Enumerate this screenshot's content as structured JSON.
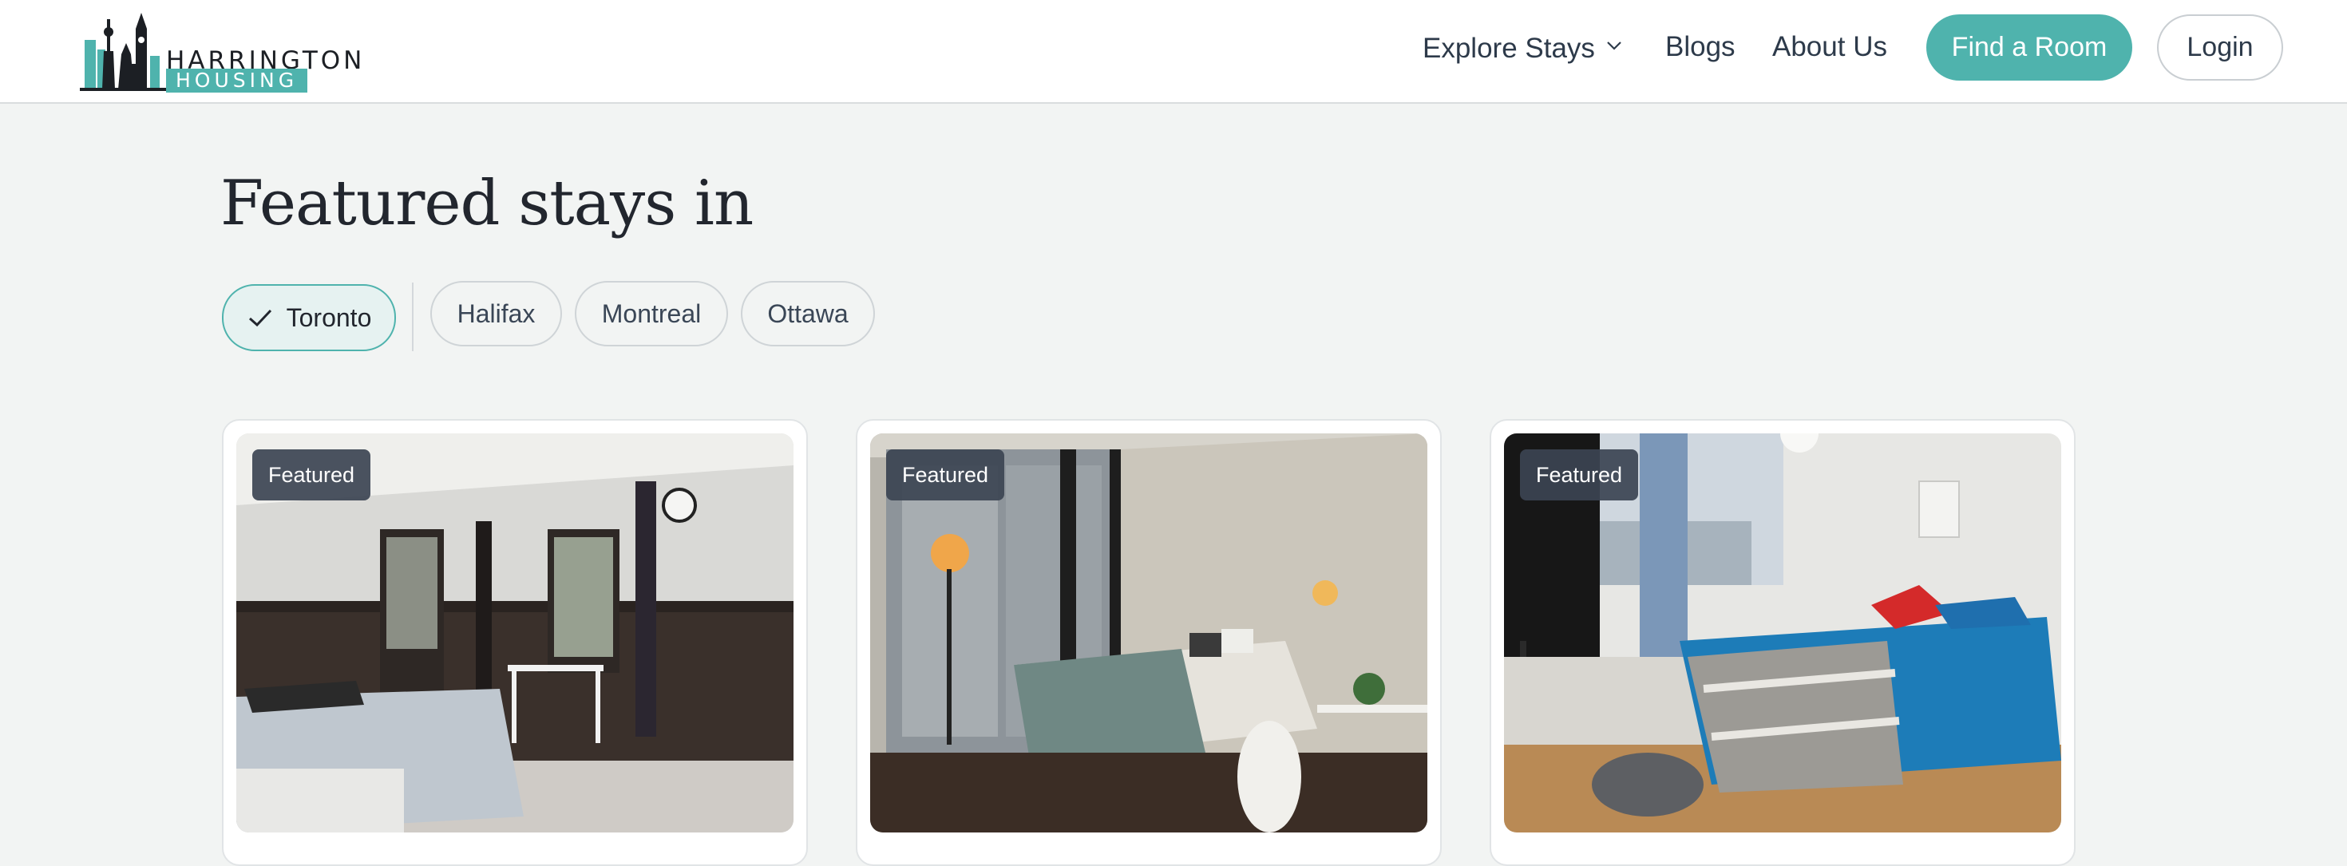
{
  "brand": {
    "name_top": "HARRINGTON",
    "name_bottom": "HOUSING",
    "accent_color": "#4fb3ad"
  },
  "nav": {
    "explore_label": "Explore Stays",
    "explore_icon": "chevron-down-icon",
    "blogs_label": "Blogs",
    "about_label": "About Us",
    "find_room_label": "Find a Room",
    "login_label": "Login"
  },
  "featured": {
    "title": "Featured stays in",
    "cities": [
      {
        "label": "Toronto",
        "selected": true,
        "icon": "check-icon"
      },
      {
        "label": "Halifax",
        "selected": false
      },
      {
        "label": "Montreal",
        "selected": false
      },
      {
        "label": "Ottawa",
        "selected": false
      }
    ],
    "listings": [
      {
        "badge": "Featured",
        "photo": "bedroom-photo-dark-wood-trim"
      },
      {
        "badge": "Featured",
        "photo": "bedroom-photo-window-city-view"
      },
      {
        "badge": "Featured",
        "photo": "bedroom-photo-blue-bedding"
      }
    ]
  }
}
